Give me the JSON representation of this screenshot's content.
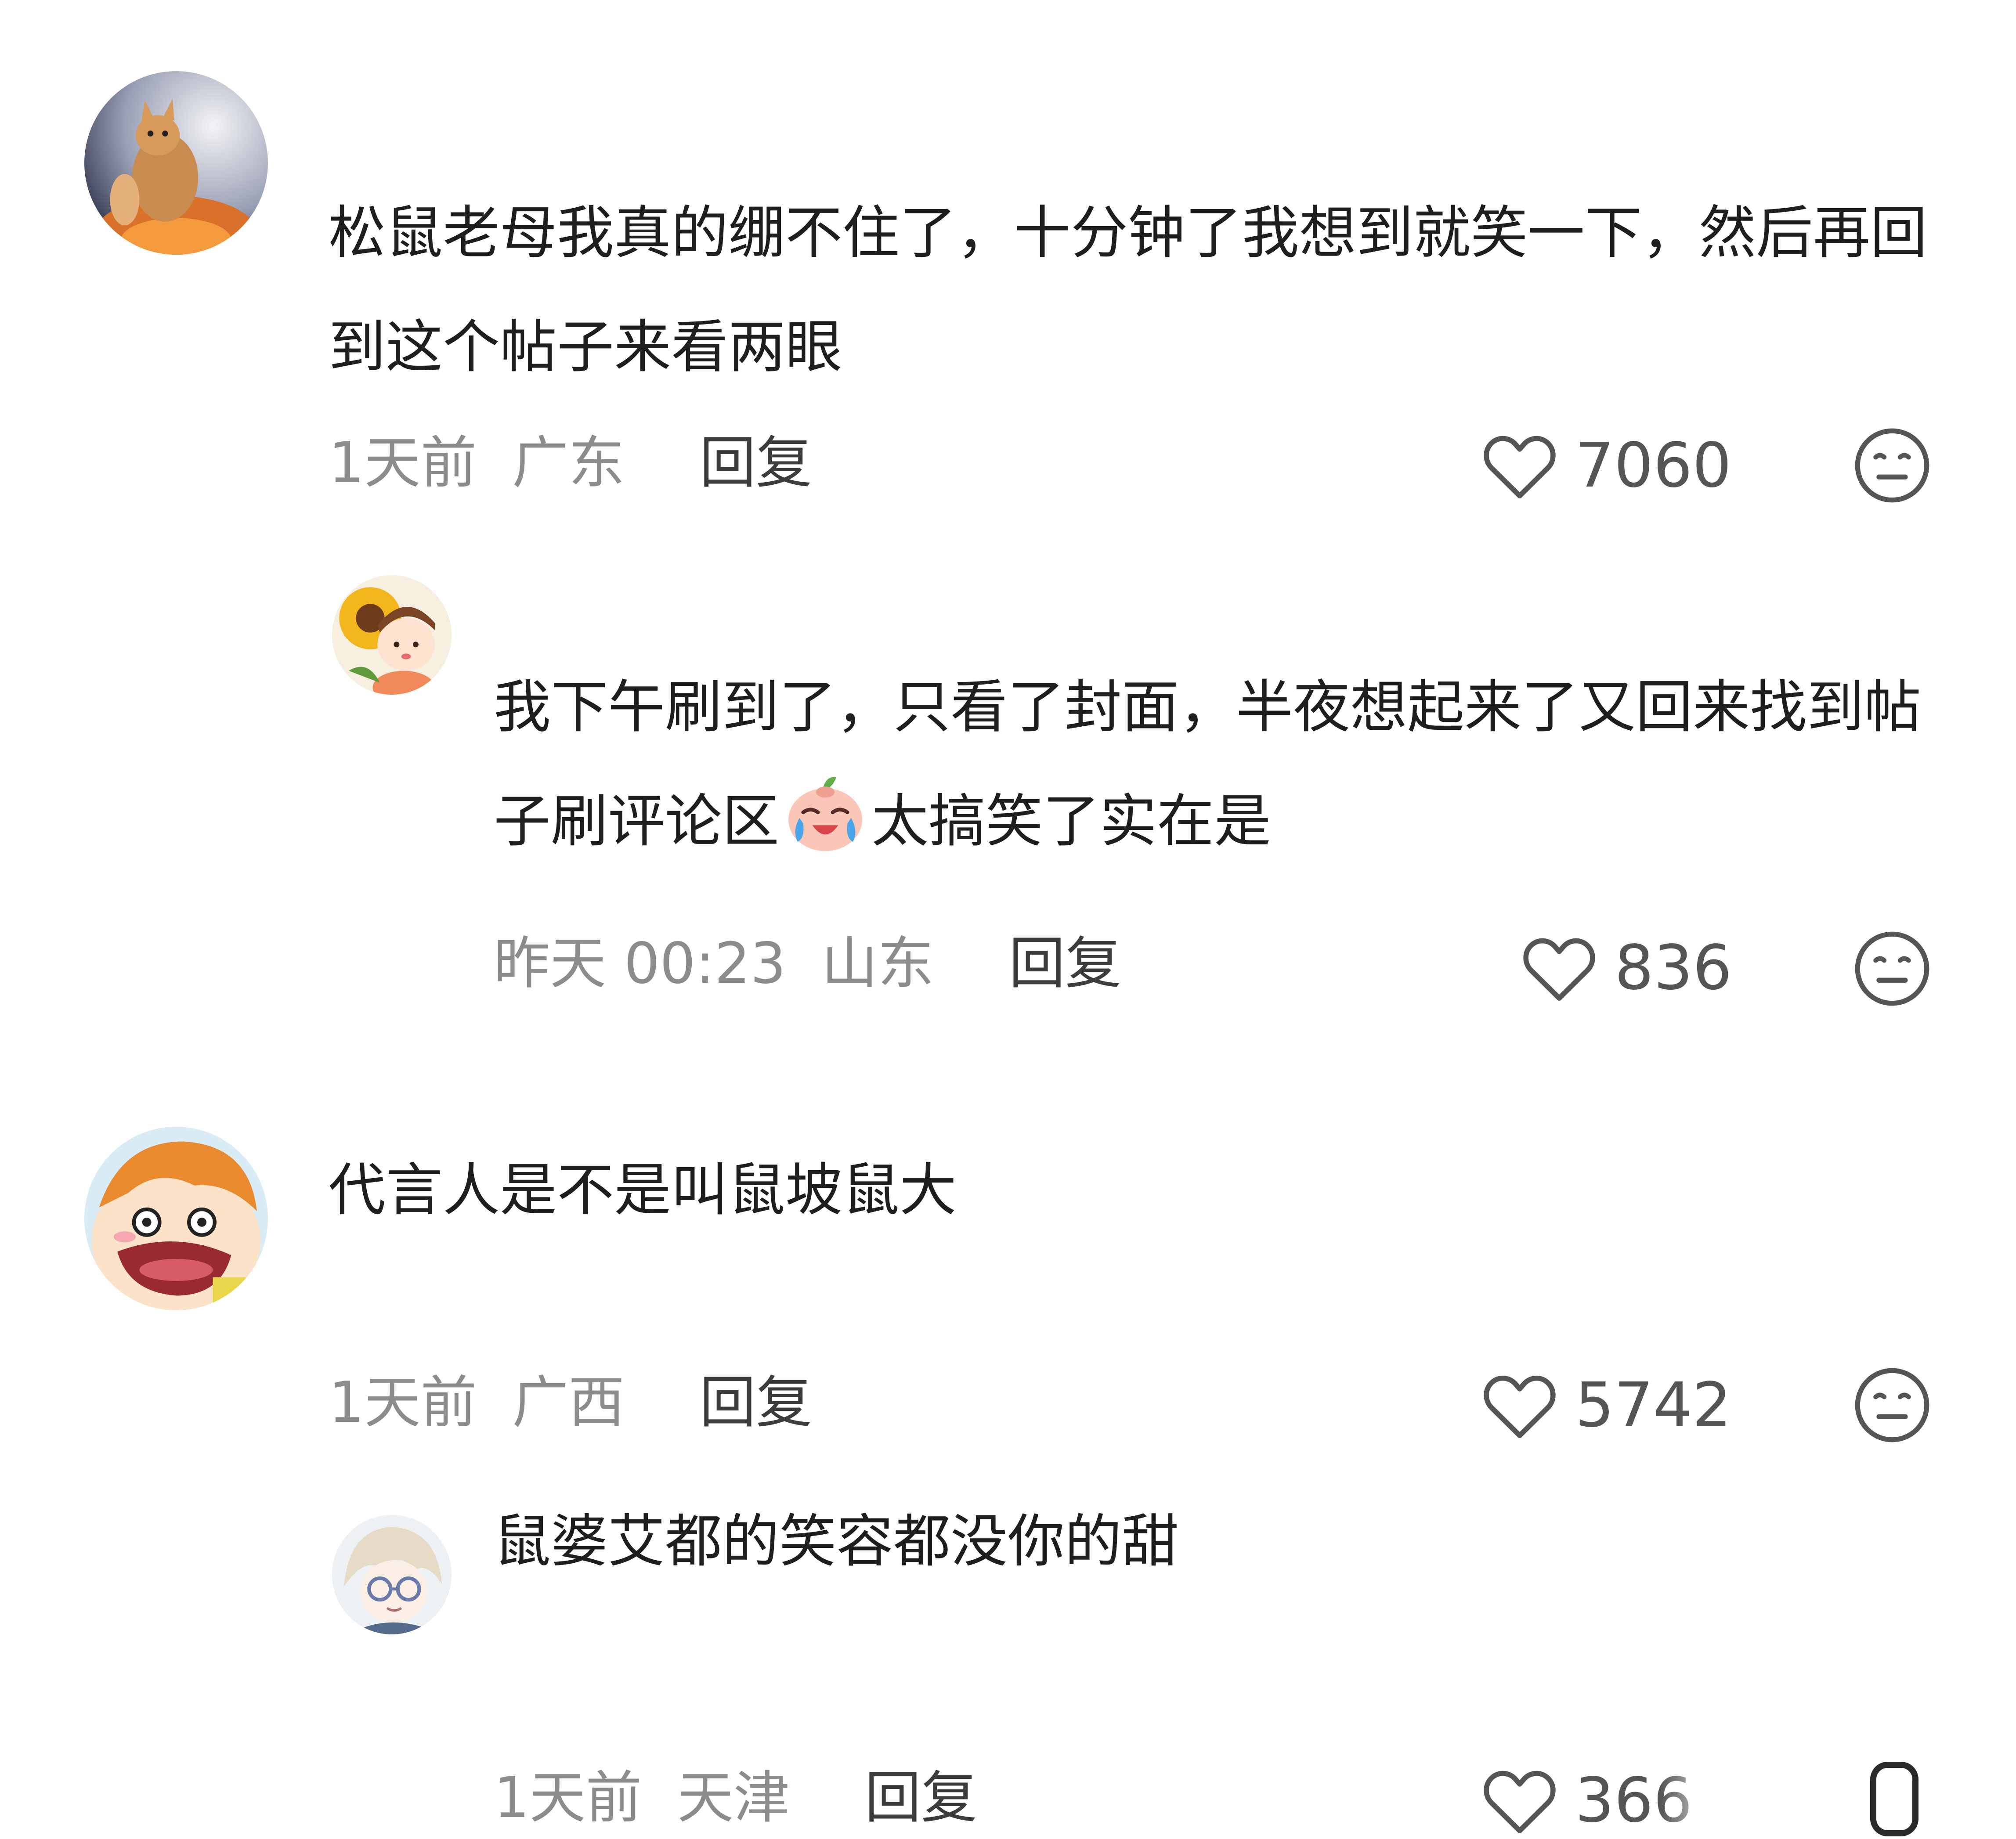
{
  "comments": [
    {
      "text": "松鼠老母我真的绷不住了，十分钟了我想到就笑一下，然后再回到这个帖子来看两眼",
      "time": "1天前",
      "location": "广东",
      "reply_label": "回复",
      "likes": "7060"
    },
    {
      "text_part1": "我下午刷到了，只看了封面，半夜想起来了又回来找到帖子刷评论区",
      "emoji": "crying-laughing-emoji",
      "text_part2": "太搞笑了实在是",
      "time": "昨天 00:23",
      "location": "山东",
      "reply_label": "回复",
      "likes": "836"
    },
    {
      "text": "代言人是不是叫鼠坡鼠大",
      "time": "1天前",
      "location": "广西",
      "reply_label": "回复",
      "likes": "5742"
    },
    {
      "text": "鼠婆艾都的笑容都没你的甜",
      "time": "1天前",
      "location": "天津",
      "reply_label": "回复",
      "likes": "366"
    }
  ],
  "colors": {
    "text": "#1e1e1e",
    "meta": "#8c8c8c",
    "reply": "#3c3c3c",
    "icon": "#555555"
  },
  "icons": {
    "like": "heart-outline-icon",
    "dislike": "neutral-face-icon"
  }
}
